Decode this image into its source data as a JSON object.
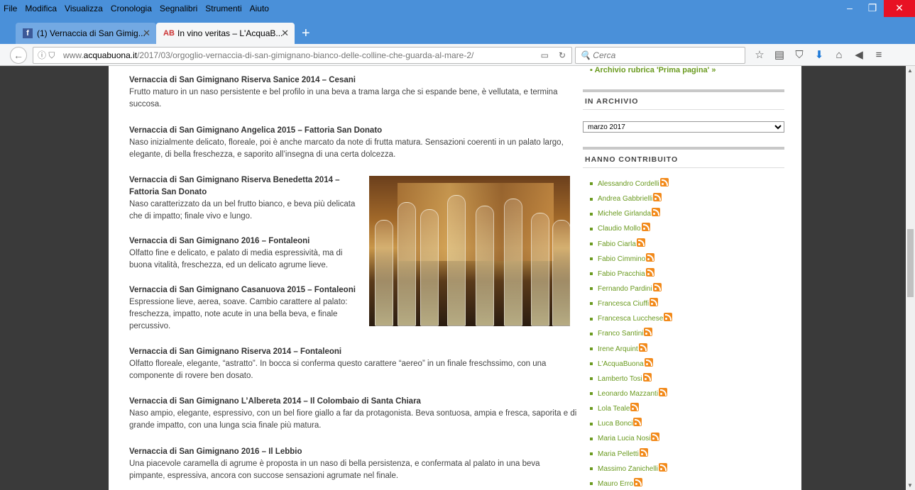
{
  "menu": [
    "File",
    "Modifica",
    "Visualizza",
    "Cronologia",
    "Segnalibri",
    "Strumenti",
    "Aiuto"
  ],
  "menu_accel": [
    "F",
    "M",
    "V",
    "C",
    "e",
    "S",
    "A"
  ],
  "window_controls": {
    "minimize": "–",
    "restore": "❐",
    "close": "✕"
  },
  "tabs": [
    {
      "label": "(1) Vernaccia di San Gimig...",
      "icon": "facebook-icon",
      "active": false
    },
    {
      "label": "In vino veritas – L'AcquaB...",
      "icon": "acquabuona-icon",
      "active": true
    }
  ],
  "new_tab": "+",
  "url": {
    "prefix": "www.",
    "domain": "acquabuona.it",
    "path": "/2017/03/orgoglio-vernaccia-di-san-gimignano-bianco-delle-colline-che-guarda-al-mare-2/"
  },
  "search": {
    "placeholder": "Cerca"
  },
  "article": [
    {
      "title": "Vernaccia di San Gimignano Riserva Sanice 2014 – Cesani",
      "text": "Frutto maturo in un naso persistente e bel profilo in una beva a trama larga che si espande bene, è vellutata, e termina succosa."
    },
    {
      "title": "Vernaccia di San Gimignano Angelica 2015 – Fattoria San Donato",
      "text": "Naso inizialmente delicato, floreale, poi è anche marcato da note di frutta matura. Sensazioni coerenti in un palato largo, elegante, di bella freschezza, e saporito all’insegna di una certa dolcezza."
    },
    {
      "title": "Vernaccia di San Gimignano Riserva Benedetta 2014 – Fattoria San Donato",
      "text": "Naso caratterizzato da un bel frutto bianco, e beva più delicata che di impatto; finale vivo e lungo."
    },
    {
      "title": "Vernaccia di San Gimignano 2016 – Fontaleoni",
      "text": "Olfatto fine e delicato, e palato di media espressività, ma di buona vitalità, freschezza, ed un delicato agrume lieve."
    },
    {
      "title": "Vernaccia di San Gimignano Casanuova 2015 – Fontaleoni",
      "text": "Espressione lieve, aerea, soave. Cambio carattere al palato: freschezza, impatto, note acute in una bella beva, e finale percussivo."
    },
    {
      "title": "Vernaccia di San Gimignano Riserva 2014 – Fontaleoni",
      "text": "Olfatto floreale, elegante, “astratto”. In bocca si conferma questo carattere “aereo” in un finale freschssimo, con una componente di rovere ben dosato."
    },
    {
      "title": "Vernaccia di San Gimignano L’Albereta 2014 – Il Colombaio di Santa Chiara",
      "text": "Naso ampio, elegante, espressivo, con un bel fiore giallo a far da protagonista. Beva sontuosa, ampia e fresca, saporita e di grande impatto, con una lunga scia finale più matura."
    },
    {
      "title": "Vernaccia di San Gimignano 2016 – Il Lebbio",
      "text": "Una piacevole caramella di agrume è proposta in un naso  di bella persistenza, e confermata al palato in una beva pimpante, espressiva, ancora con succose sensazioni agrumate nel finale."
    }
  ],
  "sidebar": {
    "top_link": "Archivio rubrica 'Prima pagina' »",
    "archive_heading": "IN ARCHIVIO",
    "archive_selected": "marzo 2017",
    "contributors_heading": "HANNO CONTRIBUITO",
    "contributors": [
      "Alessandro Cordelli",
      "Andrea Gabbrielli",
      "Michele Girlanda",
      "Claudio Mollo",
      "Fabio Ciarla",
      "Fabio Cimmino",
      "Fabio Pracchia",
      "Fernando Pardini",
      "Francesca Ciuffi",
      "Francesca Lucchese",
      "Franco Santini",
      "Irene Arquint",
      "L'AcquaBuona",
      "Lamberto Tosi",
      "Leonardo Mazzanti",
      "Lola Teale",
      "Luca Bonci",
      "Maria Lucia Nosi",
      "Maria Pelletti",
      "Massimo Zanichelli",
      "Mauro Erro"
    ]
  },
  "colors": {
    "accent_link": "#6a9a1f",
    "titlebar": "#4a90d9",
    "rss": "#f28a1b"
  }
}
